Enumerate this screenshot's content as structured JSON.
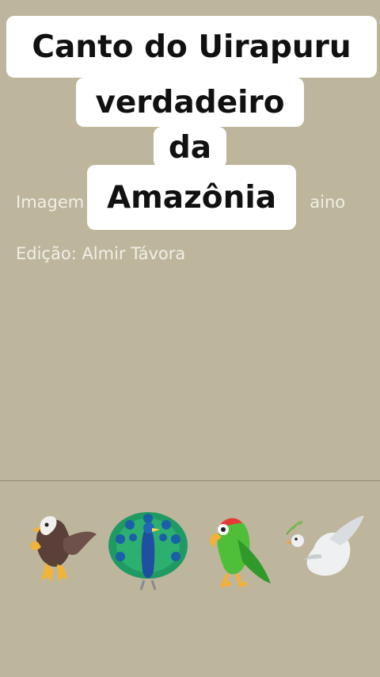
{
  "overlay_title": {
    "line1": "Canto do Uirapuru",
    "line2": "verdadeiro",
    "line3": "da",
    "line4": "Amazônia"
  },
  "credits": {
    "image_partial": "Imagem",
    "image_suffix": "aino",
    "edit": "Edição: Almir Távora"
  },
  "emojis": [
    "eagle-icon",
    "peacock-icon",
    "parrot-icon",
    "dove-icon"
  ],
  "colors": {
    "background": "#bdb69c",
    "title_box": "#ffffff",
    "title_text": "#111111",
    "credit_text": "#f1efe6"
  }
}
